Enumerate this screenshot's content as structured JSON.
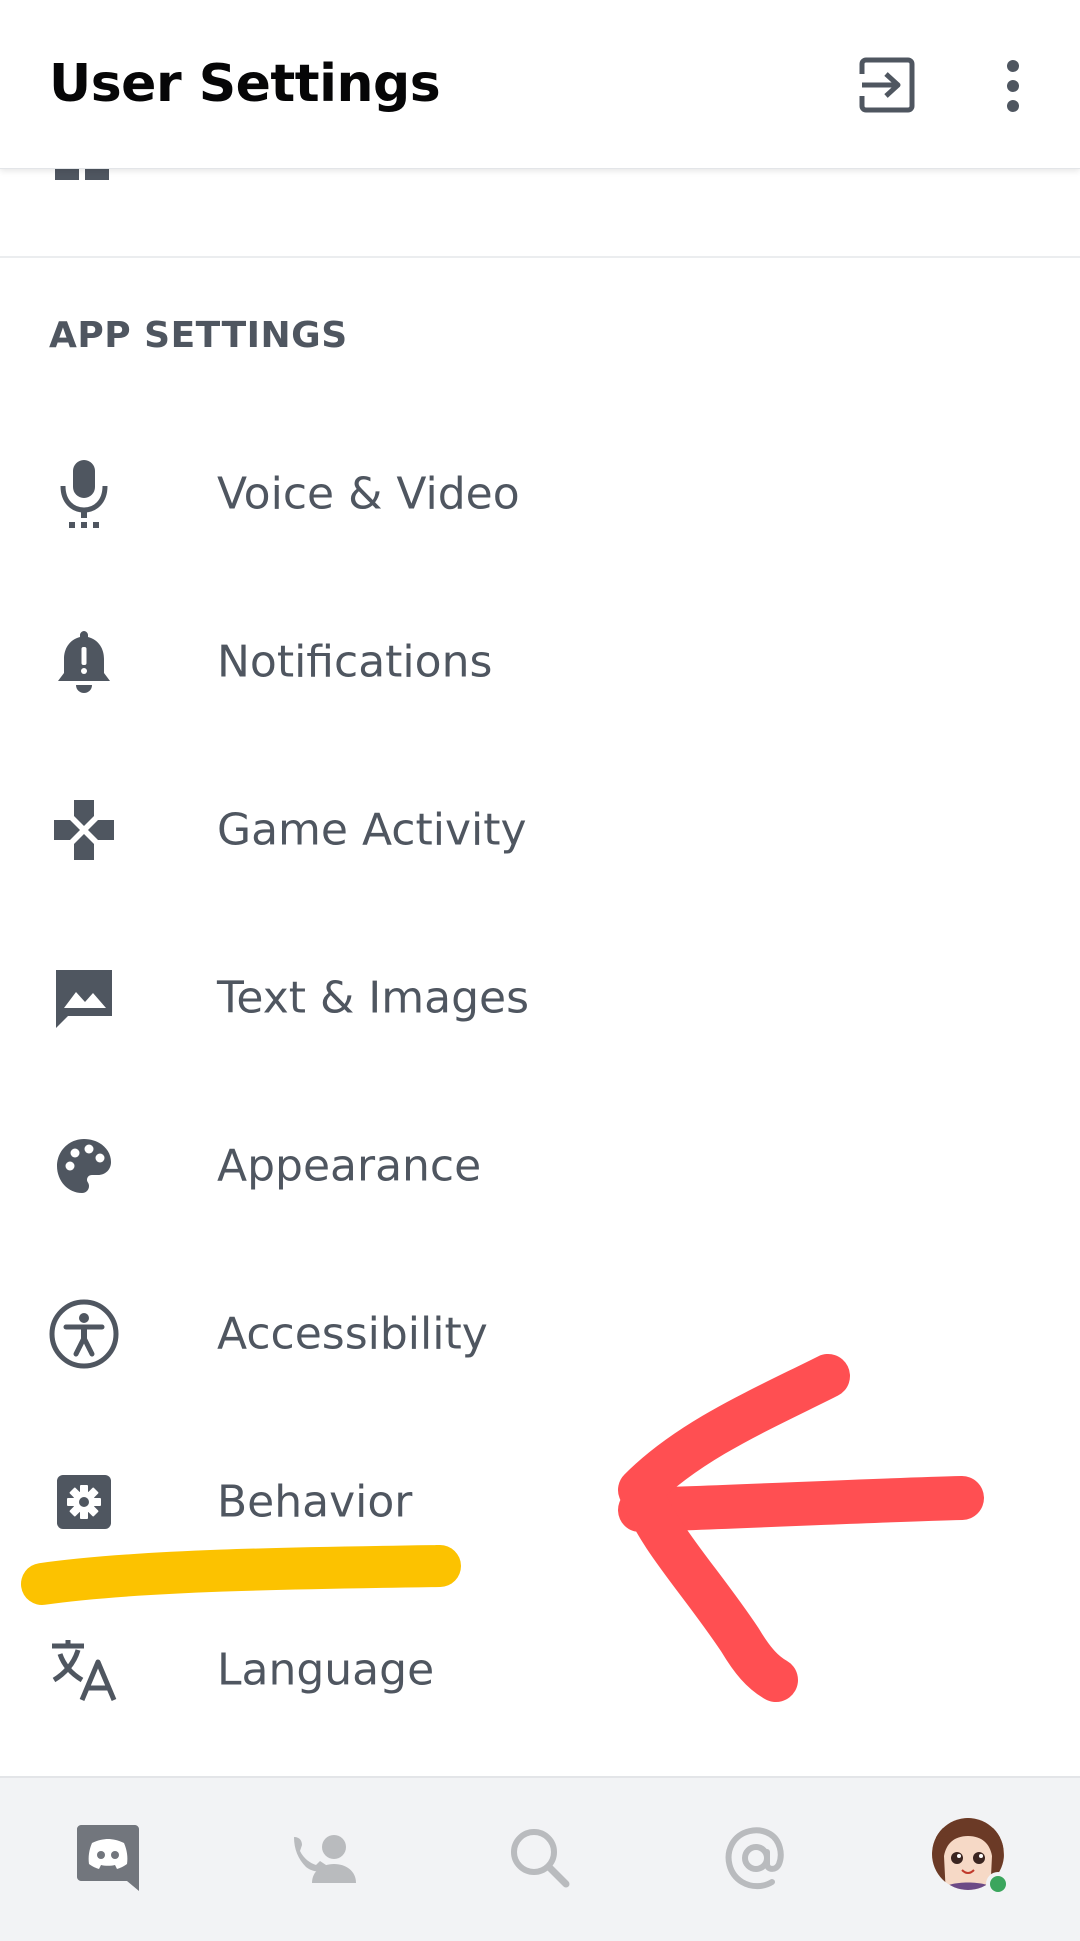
{
  "header": {
    "title": "User Settings",
    "logout_icon": "logout-icon",
    "more_icon": "more-vertical-icon"
  },
  "section": {
    "title": "APP SETTINGS"
  },
  "menu": {
    "items": [
      {
        "label": "Voice & Video",
        "icon": "microphone-icon"
      },
      {
        "label": "Notifications",
        "icon": "bell-icon"
      },
      {
        "label": "Game Activity",
        "icon": "gamepad-icon"
      },
      {
        "label": "Text & Images",
        "icon": "image-message-icon"
      },
      {
        "label": "Appearance",
        "icon": "palette-icon"
      },
      {
        "label": "Accessibility",
        "icon": "accessibility-icon"
      },
      {
        "label": "Behavior",
        "icon": "gear-icon"
      },
      {
        "label": "Language",
        "icon": "translate-icon"
      }
    ]
  },
  "bottom_nav": {
    "items": [
      {
        "icon": "discord-home-icon",
        "selected": true
      },
      {
        "icon": "friends-icon"
      },
      {
        "icon": "search-icon"
      },
      {
        "icon": "mentions-icon"
      },
      {
        "icon": "avatar-icon",
        "status": "online"
      }
    ]
  },
  "colors": {
    "icon": "#4f5660",
    "text": "#4f5660",
    "title": "#060607",
    "nav_bg": "#f2f3f5",
    "nav_icon": "#b9bbbe",
    "highlight_yellow": "#fcc200",
    "arrow_red": "#ff4f52",
    "online": "#3ba55d"
  }
}
